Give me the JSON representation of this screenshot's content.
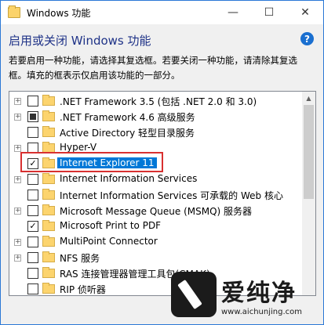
{
  "window": {
    "title": "Windows 功能"
  },
  "title_buttons": {
    "minimize": "—",
    "maximize": "☐",
    "close": "✕"
  },
  "heading": "启用或关闭 Windows 功能",
  "help_label": "?",
  "description": "若要启用一种功能，请选择其复选框。若要关闭一种功能，请清除其复选框。填充的框表示仅启用该功能的一部分。",
  "features": [
    {
      "label": ".NET Framework 3.5 (包括 .NET 2.0 和 3.0)",
      "expandable": true,
      "state": "unchecked"
    },
    {
      "label": ".NET Framework 4.6 高级服务",
      "expandable": true,
      "state": "partial"
    },
    {
      "label": "Active Directory 轻型目录服务",
      "expandable": false,
      "state": "unchecked"
    },
    {
      "label": "Hyper-V",
      "expandable": true,
      "state": "unchecked"
    },
    {
      "label": "Internet Explorer 11",
      "expandable": false,
      "state": "checked",
      "selected": true
    },
    {
      "label": "Internet Information Services",
      "expandable": true,
      "state": "unchecked"
    },
    {
      "label": "Internet Information Services 可承载的 Web 核心",
      "expandable": false,
      "state": "unchecked"
    },
    {
      "label": "Microsoft Message Queue (MSMQ) 服务器",
      "expandable": true,
      "state": "unchecked"
    },
    {
      "label": "Microsoft Print to PDF",
      "expandable": false,
      "state": "checked"
    },
    {
      "label": "MultiPoint Connector",
      "expandable": true,
      "state": "unchecked"
    },
    {
      "label": "NFS 服务",
      "expandable": true,
      "state": "unchecked"
    },
    {
      "label": "RAS 连接管理器管理工具包(CMAK)",
      "expandable": false,
      "state": "unchecked"
    },
    {
      "label": "RIP 侦听器",
      "expandable": false,
      "state": "unchecked"
    }
  ],
  "watermark": {
    "brand": "爱纯净",
    "url": "www.aichunjing.com"
  },
  "colors": {
    "selection": "#0078d7",
    "highlight_border": "#d83030",
    "heading": "#1e3287"
  }
}
